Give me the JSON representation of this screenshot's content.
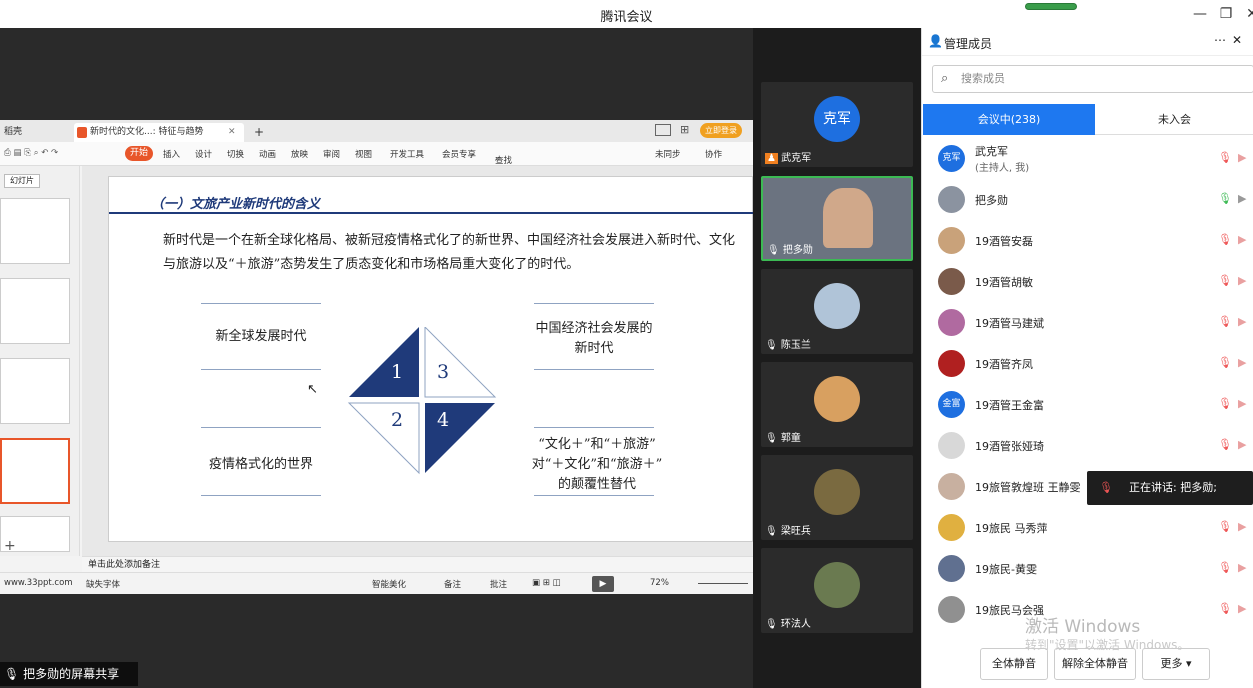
{
  "app_title": "腾讯会议",
  "wps": {
    "tabs": [
      "稻壳",
      "新时代的文化...: 特征与趋势",
      "+"
    ],
    "menu": [
      "开始",
      "插入",
      "设计",
      "切换",
      "动画",
      "放映",
      "审阅",
      "视图",
      "开发工具",
      "会员专享",
      "查找命令、搜索模板",
      "未同步",
      "协作"
    ],
    "login_badge": "立即登录",
    "thumbs_label": "幻灯片",
    "notes_placeholder": "单击此处添加备注",
    "status": {
      "site": "www.33ppt.com",
      "missing_font": "缺失字体",
      "smart": "智能美化",
      "notes": "备注",
      "comments": "批注",
      "zoom": "72%"
    },
    "slide": {
      "title": "（一）文旅产业新时代的含义",
      "body": "新时代是一个在新全球化格局、被新冠疫情格式化了的新世界、中国经济社会发展进入新时代、文化与旅游以及“＋旅游”态势发生了质态变化和市场格局重大变化了的时代。",
      "q1": "新全球发展时代",
      "q3": "中国经济社会发展的新时代",
      "q2": "疫情格式化的世界",
      "q4a": "“文化＋”和“＋旅游”",
      "q4b": "对“＋文化”和“旅游＋”",
      "q4c": "的颠覆性替代",
      "n1": "1",
      "n2": "2",
      "n3": "3",
      "n4": "4"
    }
  },
  "share_label": "把多勋的屏幕共享",
  "gallery": [
    {
      "name": "武克军",
      "avatar_text": "克军"
    },
    {
      "name": "把多勋"
    },
    {
      "name": "陈玉兰"
    },
    {
      "name": "郭童"
    },
    {
      "name": "梁旺兵"
    },
    {
      "name": "环法人"
    }
  ],
  "panel": {
    "title": "管理成员",
    "search_placeholder": "搜索成员",
    "tab_in": "会议中(238)",
    "tab_out": "未入会",
    "members": [
      {
        "name": "武克军",
        "sub": "(主持人, 我)",
        "av": "克军",
        "color": "#1e6fe0"
      },
      {
        "name": "把多勋",
        "av": "",
        "color": "#8b93a0"
      },
      {
        "name": "19酒管安磊",
        "av": "",
        "color": "#c9a27a"
      },
      {
        "name": "19酒管胡敏",
        "av": "",
        "color": "#7a5a4a"
      },
      {
        "name": "19酒管马建斌",
        "av": "",
        "color": "#b06aa0"
      },
      {
        "name": "19酒管齐凤",
        "av": "",
        "color": "#b02020"
      },
      {
        "name": "19酒管王金富",
        "av": "金富",
        "color": "#1e6fe0"
      },
      {
        "name": "19酒管张娅琦",
        "av": "",
        "color": "#d8d8d8"
      },
      {
        "name": "19旅管敦煌班 王静雯",
        "av": "",
        "color": "#c8b0a0"
      },
      {
        "name": "19旅民 马秀萍",
        "av": "",
        "color": "#e0b040"
      },
      {
        "name": "19旅民-黄雯",
        "av": "",
        "color": "#607090"
      },
      {
        "name": "19旅民马会强",
        "av": "",
        "color": "#909090"
      }
    ],
    "speaking_tooltip": "正在讲话: 把多勋;",
    "btn_mute_all": "全体静音",
    "btn_unmute_all": "解除全体静音",
    "btn_more": "更多"
  },
  "watermark": {
    "line1": "激活 Windows",
    "line2": "转到\"设置\"以激活 Windows。"
  }
}
